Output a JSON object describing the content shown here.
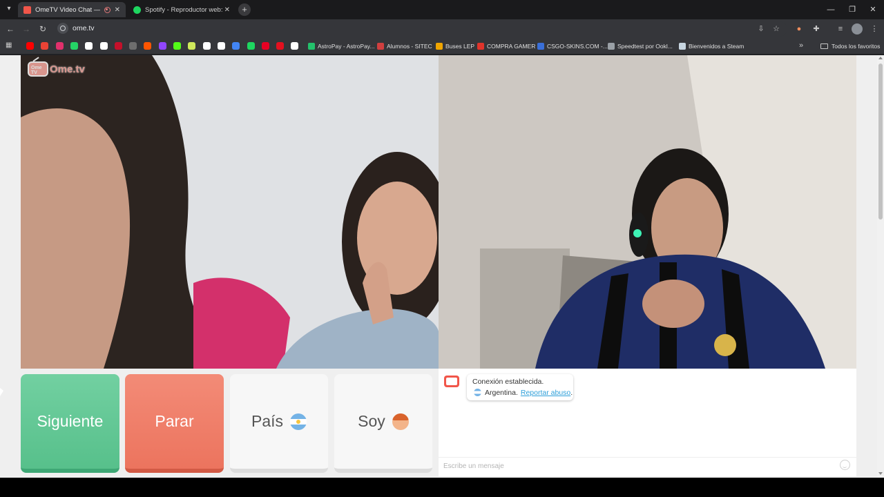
{
  "browser": {
    "tabs": [
      {
        "title": "OmeTV Video Chat — Ome",
        "active": true,
        "favicon_color": "#f1564a"
      },
      {
        "title": "Spotify - Reproductor web: mú",
        "active": false,
        "favicon_color": "#1ed760"
      }
    ],
    "new_tab_icon": "plus-icon",
    "url": "ome.tv",
    "bookmarks": [
      {
        "label": "AstroPay - AstroPay...",
        "icon_color": "#23c16b"
      },
      {
        "label": "Alumnos - SITEC",
        "icon_color": "#d13f3f"
      },
      {
        "label": "Buses LEP",
        "icon_color": "#f0a500"
      },
      {
        "label": "COMPRA GAMER",
        "icon_color": "#e0342b"
      },
      {
        "label": "CSGO-SKINS.COM -...",
        "icon_color": "#3a6fd8"
      },
      {
        "label": "Speedtest por Ookl...",
        "icon_color": "#9aa0a6"
      },
      {
        "label": "Bienvenidos a Steam",
        "icon_color": "#c7d5e0"
      }
    ],
    "bookmark_icon_colors": [
      "#ff0000",
      "#ea4335",
      "#e1306c",
      "#25d366",
      "#ffffff",
      "#ffffff",
      "#c4102a",
      "#6e6e6e",
      "#ff5500",
      "#9146ff",
      "#53fc18",
      "#cfe85b",
      "#ffffff",
      "#ffffff",
      "#4285f4",
      "#1ed760",
      "#e60023",
      "#e4101f",
      "#ffffff"
    ],
    "all_bookmarks_label": "Todos los favoritos"
  },
  "app": {
    "logo_text": "Ome.tv",
    "logo_badge": "Ome TV",
    "buttons": {
      "next": "Siguiente",
      "stop": "Parar",
      "country": "País",
      "gender": "Soy"
    },
    "colors": {
      "next": "#5cc490",
      "stop": "#ee7863",
      "link": "#2d9fd9"
    },
    "chat": {
      "status": "Conexión establecida.",
      "country": "Argentina.",
      "report_link": "Reportar abuso",
      "report_suffix": ".",
      "placeholder": "Escribe un mensaje"
    }
  }
}
